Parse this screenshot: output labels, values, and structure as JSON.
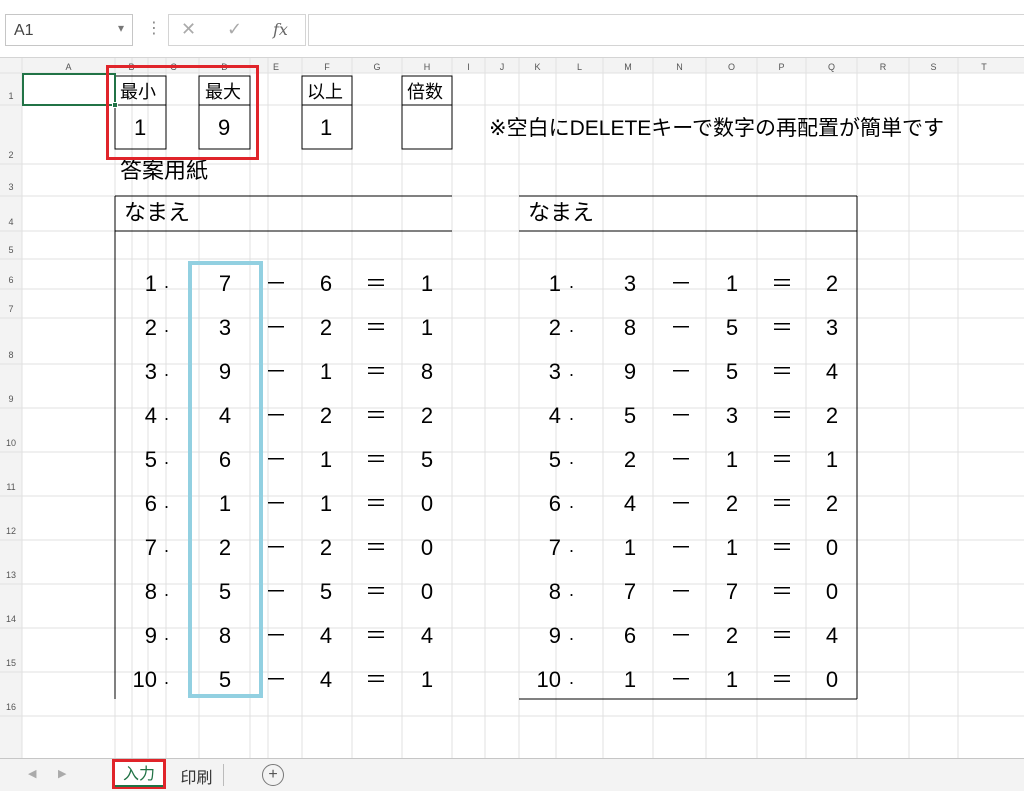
{
  "formula_bar": {
    "name_box": "A1",
    "cancel_icon": "✕",
    "enter_icon": "✓",
    "fx_label": "fx",
    "formula": ""
  },
  "columns": [
    "A",
    "B",
    "C",
    "D",
    "E",
    "F",
    "G",
    "H",
    "I",
    "J",
    "K",
    "L",
    "M",
    "N",
    "O",
    "P",
    "Q",
    "R",
    "S",
    "T"
  ],
  "rows": [
    "1",
    "2",
    "3",
    "4",
    "5",
    "6",
    "7",
    "8",
    "9",
    "10",
    "11",
    "12",
    "13",
    "14",
    "15",
    "16"
  ],
  "settings": {
    "min_label": "最小",
    "min_value": "1",
    "max_label": "最大",
    "max_value": "9",
    "above_label": "以上",
    "above_value": "1",
    "multiple_label": "倍数",
    "multiple_value": "",
    "note": "※空白にDELETEキーで数字の再配置が簡単です"
  },
  "sheet_title": "答案用紙",
  "name_label": "なまえ",
  "operator_minus": "－",
  "operator_equals": "＝",
  "dot": ".",
  "left_problems": [
    {
      "n": "1",
      "a": "7",
      "b": "6",
      "c": "1"
    },
    {
      "n": "2",
      "a": "3",
      "b": "2",
      "c": "1"
    },
    {
      "n": "3",
      "a": "9",
      "b": "1",
      "c": "8"
    },
    {
      "n": "4",
      "a": "4",
      "b": "2",
      "c": "2"
    },
    {
      "n": "5",
      "a": "6",
      "b": "1",
      "c": "5"
    },
    {
      "n": "6",
      "a": "1",
      "b": "1",
      "c": "0"
    },
    {
      "n": "7",
      "a": "2",
      "b": "2",
      "c": "0"
    },
    {
      "n": "8",
      "a": "5",
      "b": "5",
      "c": "0"
    },
    {
      "n": "9",
      "a": "8",
      "b": "4",
      "c": "4"
    },
    {
      "n": "10",
      "a": "5",
      "b": "4",
      "c": "1"
    }
  ],
  "right_problems": [
    {
      "n": "1",
      "a": "3",
      "b": "1",
      "c": "2"
    },
    {
      "n": "2",
      "a": "8",
      "b": "5",
      "c": "3"
    },
    {
      "n": "3",
      "a": "9",
      "b": "5",
      "c": "4"
    },
    {
      "n": "4",
      "a": "5",
      "b": "3",
      "c": "2"
    },
    {
      "n": "5",
      "a": "2",
      "b": "1",
      "c": "1"
    },
    {
      "n": "6",
      "a": "4",
      "b": "2",
      "c": "2"
    },
    {
      "n": "7",
      "a": "1",
      "b": "1",
      "c": "0"
    },
    {
      "n": "8",
      "a": "7",
      "b": "7",
      "c": "0"
    },
    {
      "n": "9",
      "a": "6",
      "b": "2",
      "c": "4"
    },
    {
      "n": "10",
      "a": "1",
      "b": "1",
      "c": "0"
    }
  ],
  "sheet_tabs": {
    "tabs": [
      "入力",
      "印刷"
    ],
    "active": "入力",
    "add_icon": "+"
  },
  "colors": {
    "accent": "#217346",
    "highlight_red": "#e0242a",
    "highlight_blue": "#92d0e1",
    "gridline": "#e1e1e1"
  }
}
